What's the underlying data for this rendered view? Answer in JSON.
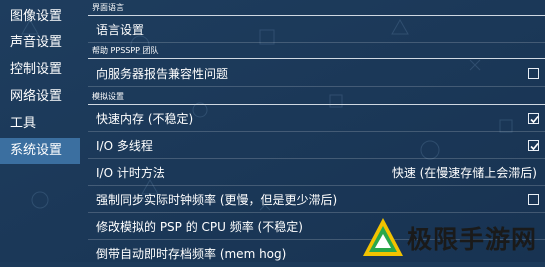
{
  "sidebar": {
    "items": [
      {
        "label": "图像设置"
      },
      {
        "label": "声音设置"
      },
      {
        "label": "控制设置"
      },
      {
        "label": "网络设置"
      },
      {
        "label": "工具"
      },
      {
        "label": "系统设置"
      }
    ],
    "active_index": 5
  },
  "sections": [
    {
      "title": "界面语言",
      "rows": [
        {
          "label": "语言设置"
        }
      ]
    },
    {
      "title": "帮助 PPSSPP 团队",
      "rows": [
        {
          "label": "向服务器报告兼容性问题",
          "checked": false
        }
      ]
    },
    {
      "title": "模拟设置",
      "rows": [
        {
          "label": "快速内存 (不稳定)",
          "checked": true
        },
        {
          "label": "I/O 多线程",
          "checked": true
        },
        {
          "label": "I/O 计时方法",
          "value": "快速 (在慢速存储上会滞后)"
        },
        {
          "label": "强制同步实际时钟频率 (更慢，但是更少滞后)",
          "checked": false
        },
        {
          "label": "修改模拟的 PSP 的 CPU 频率 (不稳定)"
        },
        {
          "label": "倒带自动即时存档频率 (mem hog)"
        }
      ]
    }
  ],
  "watermark": {
    "text": "极限手游网",
    "icon": "triangle-logo-icon"
  },
  "colors": {
    "background": "#1c3a5a",
    "sidebar_active": "#3b6fa0",
    "text": "#ffffff"
  }
}
